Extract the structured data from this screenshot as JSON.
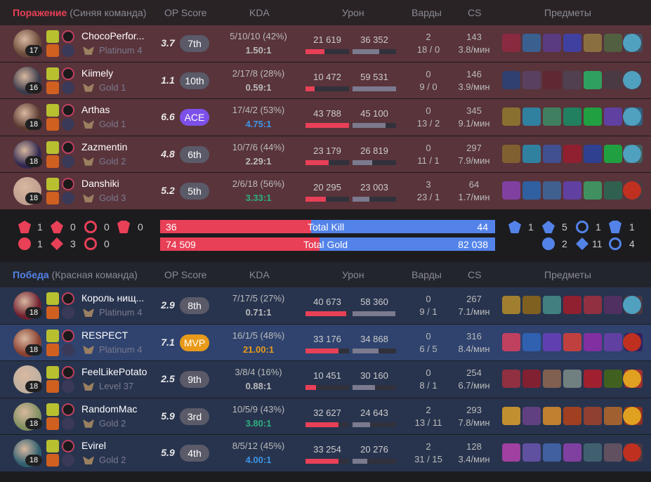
{
  "loss_header": {
    "result": "Поражение",
    "team": "(Синяя команда)",
    "opscore": "OP Score",
    "kda": "KDA",
    "damage": "Урон",
    "wards": "Варды",
    "cs": "CS",
    "items": "Предметы"
  },
  "win_header": {
    "result": "Победа",
    "team": "(Красная команда)",
    "opscore": "OP Score",
    "kda": "KDA",
    "damage": "Урон",
    "wards": "Варды",
    "cs": "CS",
    "items": "Предметы"
  },
  "loss_players": [
    {
      "name": "ChocoPerfor...",
      "level": "17",
      "rank": "Platinum 4",
      "opscore": "3.7",
      "badge": "7th",
      "kda": "5/10/10 (42%)",
      "ratio": "1.50:1",
      "ratio_color": "#bbbbbb",
      "dealt": "21 619",
      "taken": "36 352",
      "dealt_pct": 0.43,
      "taken_pct": 0.61,
      "wards": "2",
      "wards2": "18 / 0",
      "cs": "143",
      "cspm": "3.8/мин",
      "champ_color": "#6a4a3a",
      "items": [
        "#8a2a40",
        "#3a6090",
        "#5a3a80",
        "#4040a0",
        "#8a7040",
        "#506040",
        "#405060"
      ],
      "trinket": "#50a0c0"
    },
    {
      "name": "Kiimely",
      "level": "16",
      "rank": "Gold 1",
      "opscore": "1.1",
      "badge": "10th",
      "kda": "2/17/8 (28%)",
      "ratio": "0.59:1",
      "ratio_color": "#bbbbbb",
      "dealt": "10 472",
      "taken": "59 531",
      "dealt_pct": 0.21,
      "taken_pct": 1.0,
      "wards": "0",
      "wards2": "9 / 0",
      "cs": "146",
      "cspm": "3.9/мин",
      "champ_color": "#3a3a4a",
      "items": [
        "#304070",
        "#5a4060",
        "#602830",
        "#504050",
        "#30a060",
        "",
        ""
      ],
      "trinket": "#50a0c0"
    },
    {
      "name": "Arthas",
      "level": "18",
      "rank": "Gold 1",
      "opscore": "6.6",
      "badge": "ACE",
      "kda": "17/4/2 (53%)",
      "ratio": "4.75:1",
      "ratio_color": "#3d95e5",
      "dealt": "43 788",
      "taken": "45 100",
      "dealt_pct": 1.0,
      "taken_pct": 0.76,
      "wards": "0",
      "wards2": "13 / 2",
      "cs": "345",
      "cspm": "9.1/мин",
      "champ_color": "#5a3a30",
      "items": [
        "#8a7030",
        "#3080a0",
        "#408060",
        "#208060",
        "#20a040",
        "#6040a0",
        "#306080"
      ],
      "trinket": "#50a0c0"
    },
    {
      "name": "Zazmentin",
      "level": "18",
      "rank": "Gold 2",
      "opscore": "4.8",
      "badge": "6th",
      "kda": "10/7/6 (44%)",
      "ratio": "2.29:1",
      "ratio_color": "#bbbbbb",
      "dealt": "23 179",
      "taken": "26 819",
      "dealt_pct": 0.53,
      "taken_pct": 0.45,
      "wards": "0",
      "wards2": "11 / 1",
      "cs": "297",
      "cspm": "7.9/мин",
      "champ_color": "#302850",
      "items": [
        "#806030",
        "#3080a0",
        "#405090",
        "#902030",
        "#304090",
        "#20a040",
        "#406060"
      ],
      "trinket": "#50a0c0"
    },
    {
      "name": "Danshiki",
      "level": "18",
      "rank": "Gold 3",
      "opscore": "5.2",
      "badge": "5th",
      "kda": "2/6/18 (56%)",
      "ratio": "3.33:1",
      "ratio_color": "#2daf7f",
      "dealt": "20 295",
      "taken": "23 003",
      "dealt_pct": 0.46,
      "taken_pct": 0.39,
      "wards": "3",
      "wards2": "23 / 1",
      "cs": "64",
      "cspm": "1.7/мин",
      "champ_color": "#c0a090",
      "items": [
        "#8040a0",
        "#3060a0",
        "#406090",
        "#6040a0",
        "#409060",
        "#306050",
        ""
      ],
      "trinket": "#c03020"
    }
  ],
  "win_players": [
    {
      "name": "Король нищ...",
      "level": "18",
      "rank": "Platinum 4",
      "opscore": "2.9",
      "badge": "8th",
      "kda": "7/17/5 (27%)",
      "ratio": "0.71:1",
      "ratio_color": "#bbbbbb",
      "dealt": "40 673",
      "taken": "58 360",
      "dealt_pct": 0.93,
      "taken_pct": 0.98,
      "wards": "0",
      "wards2": "9 / 1",
      "cs": "267",
      "cspm": "7.1/мин",
      "champ_color": "#702030",
      "me": false,
      "items": [
        "#a08030",
        "#806020",
        "#408080",
        "#902030",
        "#903040",
        "#503060",
        ""
      ],
      "trinket": "#50a0c0"
    },
    {
      "name": "RESPECT",
      "level": "18",
      "rank": "Platinum 4",
      "opscore": "7.1",
      "badge": "MVP",
      "kda": "16/1/5 (48%)",
      "ratio": "21.00:1",
      "ratio_color": "#e89a1a",
      "dealt": "33 176",
      "taken": "34 868",
      "dealt_pct": 0.76,
      "taken_pct": 0.59,
      "wards": "0",
      "wards2": "6 / 5",
      "cs": "316",
      "cspm": "8.4/мин",
      "champ_color": "#8a4030",
      "me": true,
      "items": [
        "#c04060",
        "#3060b0",
        "#6040b0",
        "#c04040",
        "#8030a0",
        "#6040a0",
        "#302060"
      ],
      "trinket": "#c03020"
    },
    {
      "name": "FeelLikePotato",
      "level": "18",
      "rank": "Level 37",
      "opscore": "2.5",
      "badge": "9th",
      "kda": "3/8/4 (16%)",
      "ratio": "0.88:1",
      "ratio_color": "#bbbbbb",
      "dealt": "10 451",
      "taken": "30 160",
      "dealt_pct": 0.24,
      "taken_pct": 0.51,
      "wards": "0",
      "wards2": "8 / 1",
      "cs": "254",
      "cspm": "6.7/мин",
      "champ_color": "#c0b0a0",
      "me": false,
      "items": [
        "#903040",
        "#802030",
        "#806050",
        "#708080",
        "#a02030",
        "#406020",
        "#a03030"
      ],
      "trinket": "#e0a020"
    },
    {
      "name": "RandomMac",
      "level": "18",
      "rank": "Gold 2",
      "opscore": "5.9",
      "badge": "3rd",
      "kda": "10/5/9 (43%)",
      "ratio": "3.80:1",
      "ratio_color": "#2daf7f",
      "dealt": "32 627",
      "taken": "24 643",
      "dealt_pct": 0.75,
      "taken_pct": 0.41,
      "wards": "2",
      "wards2": "13 / 11",
      "cs": "293",
      "cspm": "7.8/мин",
      "champ_color": "#809060",
      "me": false,
      "items": [
        "#c09030",
        "#604080",
        "#c08030",
        "#a04020",
        "#904030",
        "#a06030",
        "#903020"
      ],
      "trinket": "#e0a020"
    },
    {
      "name": "Evirel",
      "level": "18",
      "rank": "Gold 2",
      "opscore": "5.9",
      "badge": "4th",
      "kda": "8/5/12 (45%)",
      "ratio": "4.00:1",
      "ratio_color": "#3d95e5",
      "dealt": "33 254",
      "taken": "20 276",
      "dealt_pct": 0.76,
      "taken_pct": 0.34,
      "wards": "2",
      "wards2": "31 / 15",
      "cs": "128",
      "cspm": "3.4/мин",
      "champ_color": "#306070",
      "me": false,
      "items": [
        "#a040a0",
        "#6050a0",
        "#4060a0",
        "#8040a0",
        "#406070",
        "#605060",
        ""
      ],
      "trinket": "#c03020"
    }
  ],
  "summary": {
    "left_objectives": {
      "baron": "1",
      "dragon": "0",
      "herald": "0",
      "grub": "0",
      "tower": "1",
      "inhib": "3",
      "atakhan": "0"
    },
    "right_objectives": {
      "baron": "1",
      "dragon": "5",
      "herald": "1",
      "grub": "1",
      "tower": "2",
      "inhib": "11",
      "atakhan": "4"
    },
    "kills": {
      "left": "36",
      "label": "Total Kill",
      "right": "44",
      "left_fraction": 0.45
    },
    "gold": {
      "left": "74 509",
      "label": "Total Gold",
      "right": "82 038",
      "left_fraction": 0.476
    }
  },
  "colors": {
    "loss": "#e84057",
    "win": "#5383e8"
  }
}
